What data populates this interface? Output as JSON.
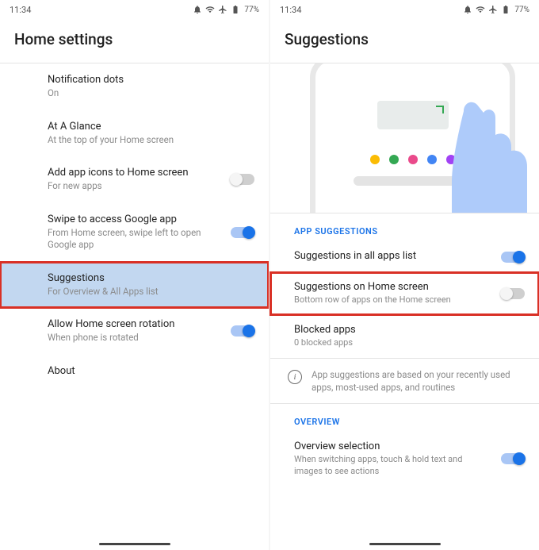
{
  "status": {
    "time": "11:34",
    "battery": "77%"
  },
  "left": {
    "title": "Home settings",
    "items": [
      {
        "title": "Notification dots",
        "sub": "On",
        "switch": null
      },
      {
        "title": "At A Glance",
        "sub": "At the top of your Home screen",
        "switch": null
      },
      {
        "title": "Add app icons to Home screen",
        "sub": "For new apps",
        "switch": "off"
      },
      {
        "title": "Swipe to access Google app",
        "sub": "From Home screen, swipe left to open Google app",
        "switch": "on"
      },
      {
        "title": "Suggestions",
        "sub": "For Overview & All Apps list",
        "switch": null
      },
      {
        "title": "Allow Home screen rotation",
        "sub": "When phone is rotated",
        "switch": "on"
      },
      {
        "title": "About",
        "sub": "",
        "switch": null
      }
    ]
  },
  "right": {
    "title": "Suggestions",
    "section1": "APP SUGGESTIONS",
    "items1": [
      {
        "title": "Suggestions in all apps list",
        "sub": "",
        "switch": "on"
      },
      {
        "title": "Suggestions on Home screen",
        "sub": "Bottom row of apps on the Home screen",
        "switch": "off"
      },
      {
        "title": "Blocked apps",
        "sub": "0 blocked apps",
        "switch": null
      }
    ],
    "info": "App suggestions are based on your recently used apps, most-used apps, and routines",
    "section2": "OVERVIEW",
    "items2": [
      {
        "title": "Overview selection",
        "sub": "When switching apps, touch & hold text and images to see actions",
        "switch": "on"
      }
    ],
    "dotColors": [
      "#fbbc04",
      "#34a853",
      "#ea4a8b",
      "#4285f4",
      "#a142f4"
    ]
  }
}
